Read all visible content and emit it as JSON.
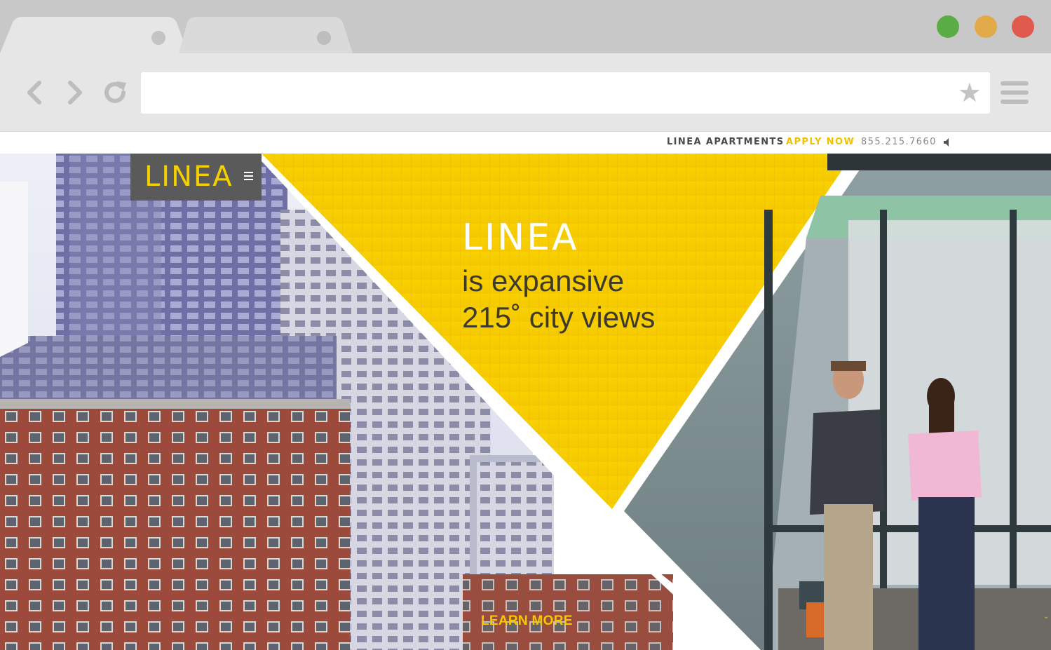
{
  "browser": {
    "url": "",
    "tabs": [
      "",
      ""
    ],
    "window_buttons": [
      {
        "name": "maximize",
        "color": "#5aac44"
      },
      {
        "name": "minimize",
        "color": "#e3aa4a"
      },
      {
        "name": "close",
        "color": "#e05a4e"
      }
    ],
    "icons": [
      "back-arrow-icon",
      "forward-arrow-icon",
      "reload-icon",
      "bookmark-star-icon",
      "menu-icon"
    ]
  },
  "site": {
    "logo": "LINEA",
    "nav": {
      "apartments": "LINEA APARTMENTS",
      "apply": "APPLY NOW",
      "phone": "855.215.7660"
    },
    "hero": {
      "brand": "LINEA",
      "line1": "is expansive",
      "line2": "215˚ city views",
      "cta": "LEARN MORE"
    },
    "colors": {
      "accent": "#f5d000",
      "logo_bg": "#5a5a5a",
      "cta": "#f5c800"
    }
  }
}
